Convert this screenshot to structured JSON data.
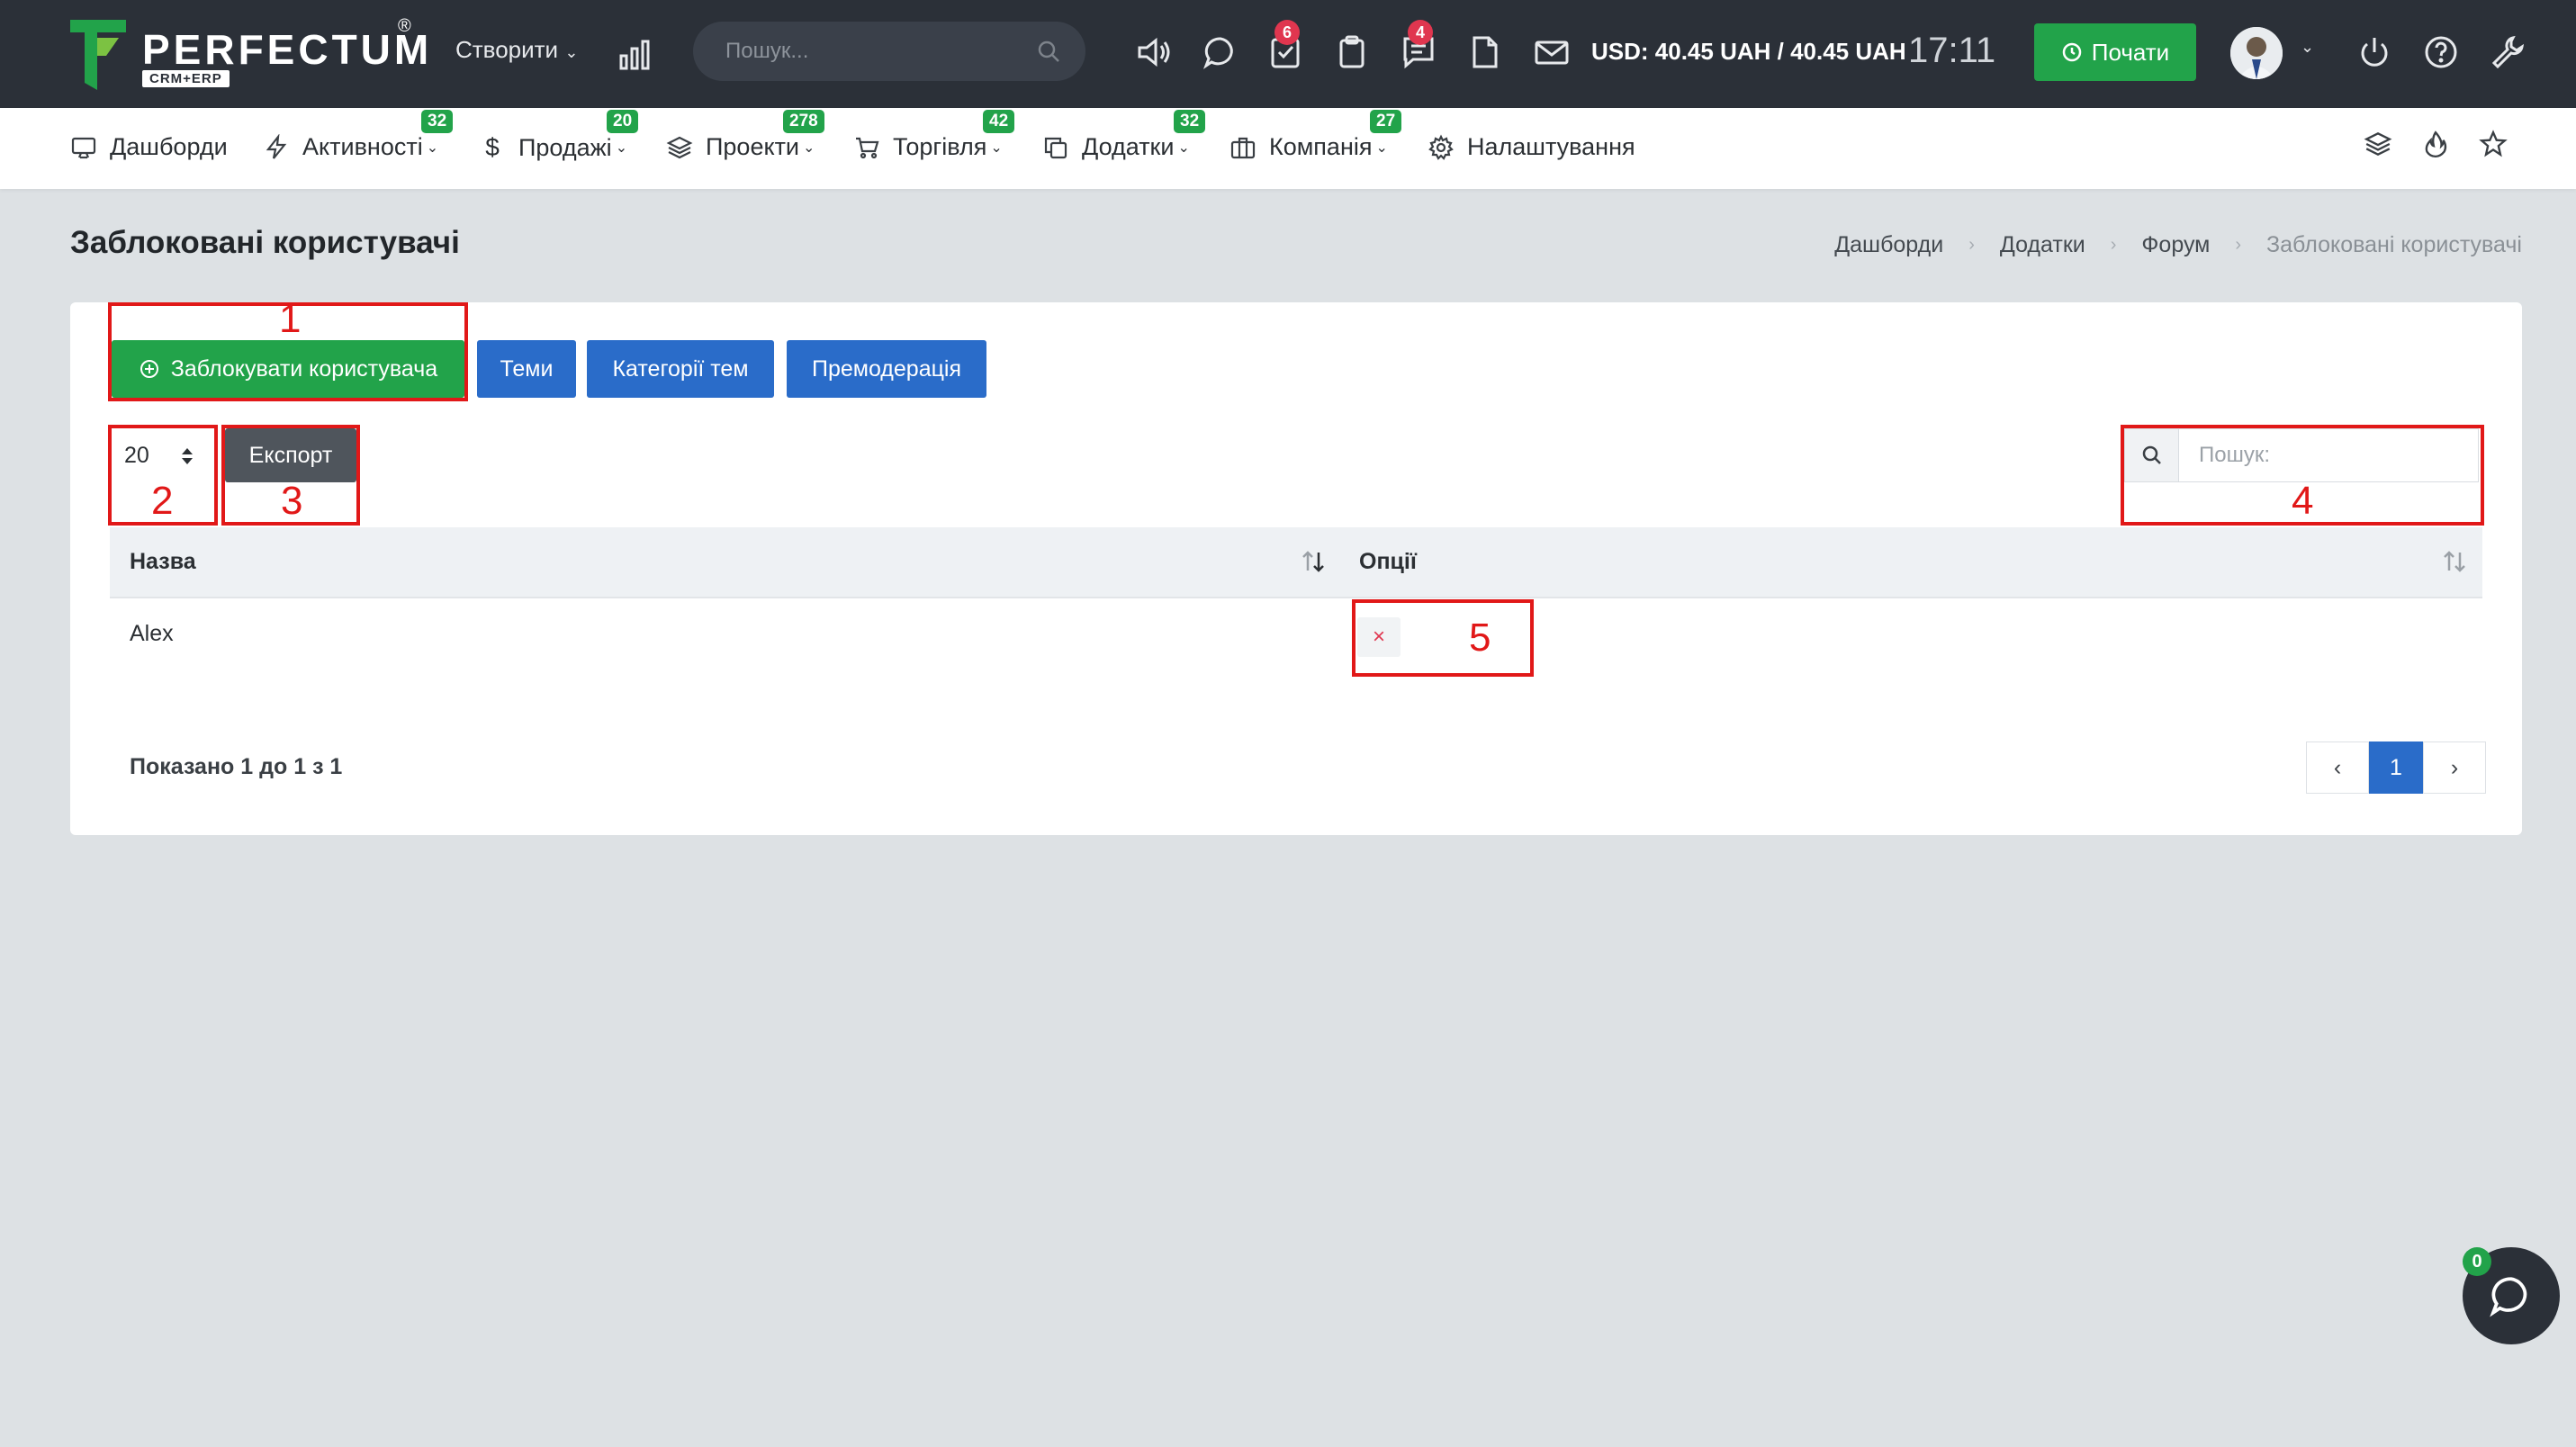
{
  "topbar": {
    "logo_text": "PERFECTUM",
    "logo_reg": "®",
    "logo_sub": "CRM+ERP",
    "create_label": "Створити",
    "search_placeholder": "Пошук...",
    "tasks_badge": "6",
    "notes_badge": "4",
    "currency": "USD: 40.45 UAH / 40.45 UAH",
    "clock": "17:11",
    "start_label": "Почати"
  },
  "nav": {
    "items": [
      {
        "label": "Дашборди",
        "icon": "monitor-icon",
        "badge": ""
      },
      {
        "label": "Активності",
        "icon": "lightning-icon",
        "badge": "32"
      },
      {
        "label": "Продажі",
        "icon": "dollar-icon",
        "badge": "20"
      },
      {
        "label": "Проекти",
        "icon": "layers-icon",
        "badge": "278"
      },
      {
        "label": "Торгівля",
        "icon": "cart-icon",
        "badge": "42"
      },
      {
        "label": "Додатки",
        "icon": "copy-icon",
        "badge": "32"
      },
      {
        "label": "Компанія",
        "icon": "briefcase-icon",
        "badge": "27"
      },
      {
        "label": "Налаштування",
        "icon": "gear-icon",
        "badge": ""
      }
    ]
  },
  "page": {
    "title": "Заблоковані користувачі",
    "breadcrumb": [
      "Дашборди",
      "Додатки",
      "Форум",
      "Заблоковані користувачі"
    ]
  },
  "toolbar": {
    "block_user_label": "Заблокувати користувача",
    "topics_label": "Теми",
    "topic_categories_label": "Категорії тем",
    "premoderation_label": "Премодерація",
    "page_length": "20",
    "export_label": "Експорт",
    "search_placeholder": "Пошук:"
  },
  "annotations": [
    "1",
    "2",
    "3",
    "4",
    "5"
  ],
  "table": {
    "columns": [
      "Назва",
      "Опції"
    ],
    "rows": [
      {
        "name": "Alex",
        "option": "×"
      }
    ],
    "info": "Показано 1 до 1 з 1",
    "pages": [
      "‹",
      "1",
      "›"
    ]
  },
  "chat": {
    "badge": "0"
  },
  "colors": {
    "topbar": "#2b3038",
    "green": "#22a34a",
    "blue": "#2a6cc9",
    "red_annotation": "#e11818",
    "badge_red": "#e0364f"
  }
}
